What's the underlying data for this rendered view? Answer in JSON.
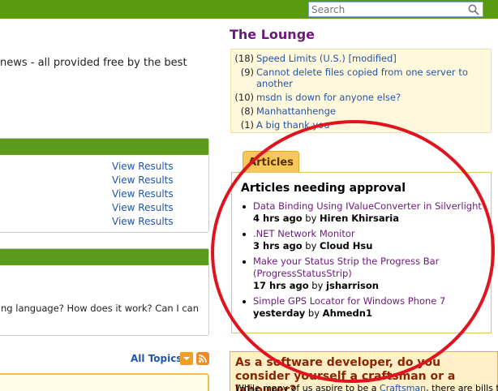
{
  "search": {
    "placeholder": "Search"
  },
  "main": {
    "news_text": "news - all provided free by the best",
    "results": [
      "View Results",
      "View Results",
      "View Results",
      "View Results",
      "View Results"
    ],
    "question_text": "ng language? How does it work? Can I can",
    "all_topics": "All Topics"
  },
  "lounge": {
    "title": "The Lounge",
    "items": [
      {
        "count": "(18)",
        "title": "Speed Limits (U.S.) [modified]"
      },
      {
        "count": "(9)",
        "title": "Cannot delete files copied from one server to another"
      },
      {
        "count": "(10)",
        "title": "msdn is down for anyone else?"
      },
      {
        "count": "(8)",
        "title": "Manhattanhenge"
      },
      {
        "count": "(1)",
        "title": "A big thank you"
      }
    ]
  },
  "articles": {
    "tab_label": "Articles",
    "heading": "Articles needing approval",
    "items": [
      {
        "title": "Data Binding Using IValueConverter in Silverlight",
        "time": "4 hrs ago",
        "by": "by",
        "author": "Hiren Khirsaria"
      },
      {
        "title": ".NET Network Monitor",
        "time": "3 hrs ago",
        "by": "by",
        "author": "Cloud Hsu"
      },
      {
        "title": "Make your Status Strip the Progress Bar (ProgressStatusStrip)",
        "time": "17 hrs ago",
        "by": "by",
        "author": "jsharrison"
      },
      {
        "title": "Simple GPS Locator for Windows Phone 7",
        "time": "yesterday",
        "by": "by",
        "author": "Ahmedn1"
      }
    ]
  },
  "survey": {
    "title": "As a software developer, do you consider yourself a craftsman or a labourer?",
    "text_before": "While many of us aspire to be a ",
    "link": "Craftsman",
    "text_after": ", there are bills to be"
  },
  "colors": {
    "topbar": "#5a9a0f",
    "lounge_title": "#6b1a7a",
    "link": "#2255aa",
    "annotation": "#e0141e"
  }
}
